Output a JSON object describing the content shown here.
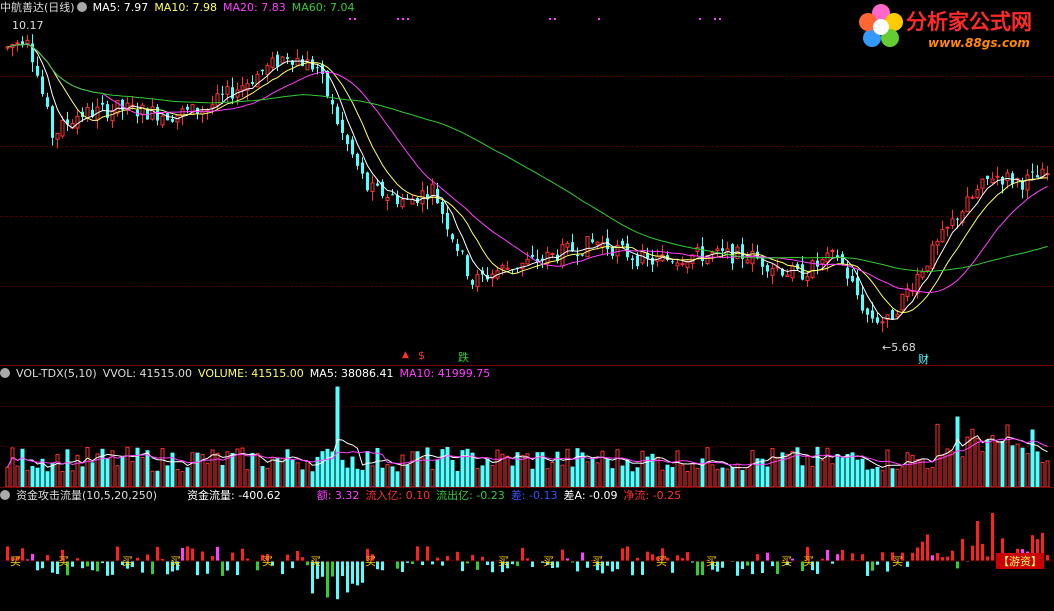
{
  "colors": {
    "up": "#ff3232",
    "down": "#54ffff",
    "ma5": "#ffffff",
    "ma10": "#ffff66",
    "ma20": "#ff40ff",
    "ma60": "#33cc33"
  },
  "main": {
    "stock_title": "中航善达(日线)",
    "ma5": "MA5: 7.97",
    "ma10": "MA10: 7.98",
    "ma20": "MA20: 7.83",
    "ma60": "MA60: 7.04",
    "high_marker": "10.17",
    "low_marker": "←5.68",
    "signal_up": "$",
    "signal_drop": "跌",
    "signal_cai": "财"
  },
  "logo": {
    "name": "分析家公式网",
    "url": "www.88gs.com"
  },
  "volume": {
    "indicator": "VOL-TDX(5,10)",
    "vvol": "VVOL: 41515.00",
    "volume": "VOLUME: 41515.00",
    "ma5": "MA5: 38086.41",
    "ma10": "MA10: 41999.75"
  },
  "fund": {
    "indicator": "资金攻击流量(10,5,20,250)",
    "flow": "资金流量: -400.62",
    "amount": "额: 3.32",
    "inflow": "流入亿: 0.10",
    "outflow": "流出亿: -0.23",
    "diff": "差: -0.13",
    "diff_a": "差A: -0.09",
    "net": "净流: -0.25",
    "buy_label": "买",
    "retail_label": "散",
    "inst_label": "【游资】"
  }
}
